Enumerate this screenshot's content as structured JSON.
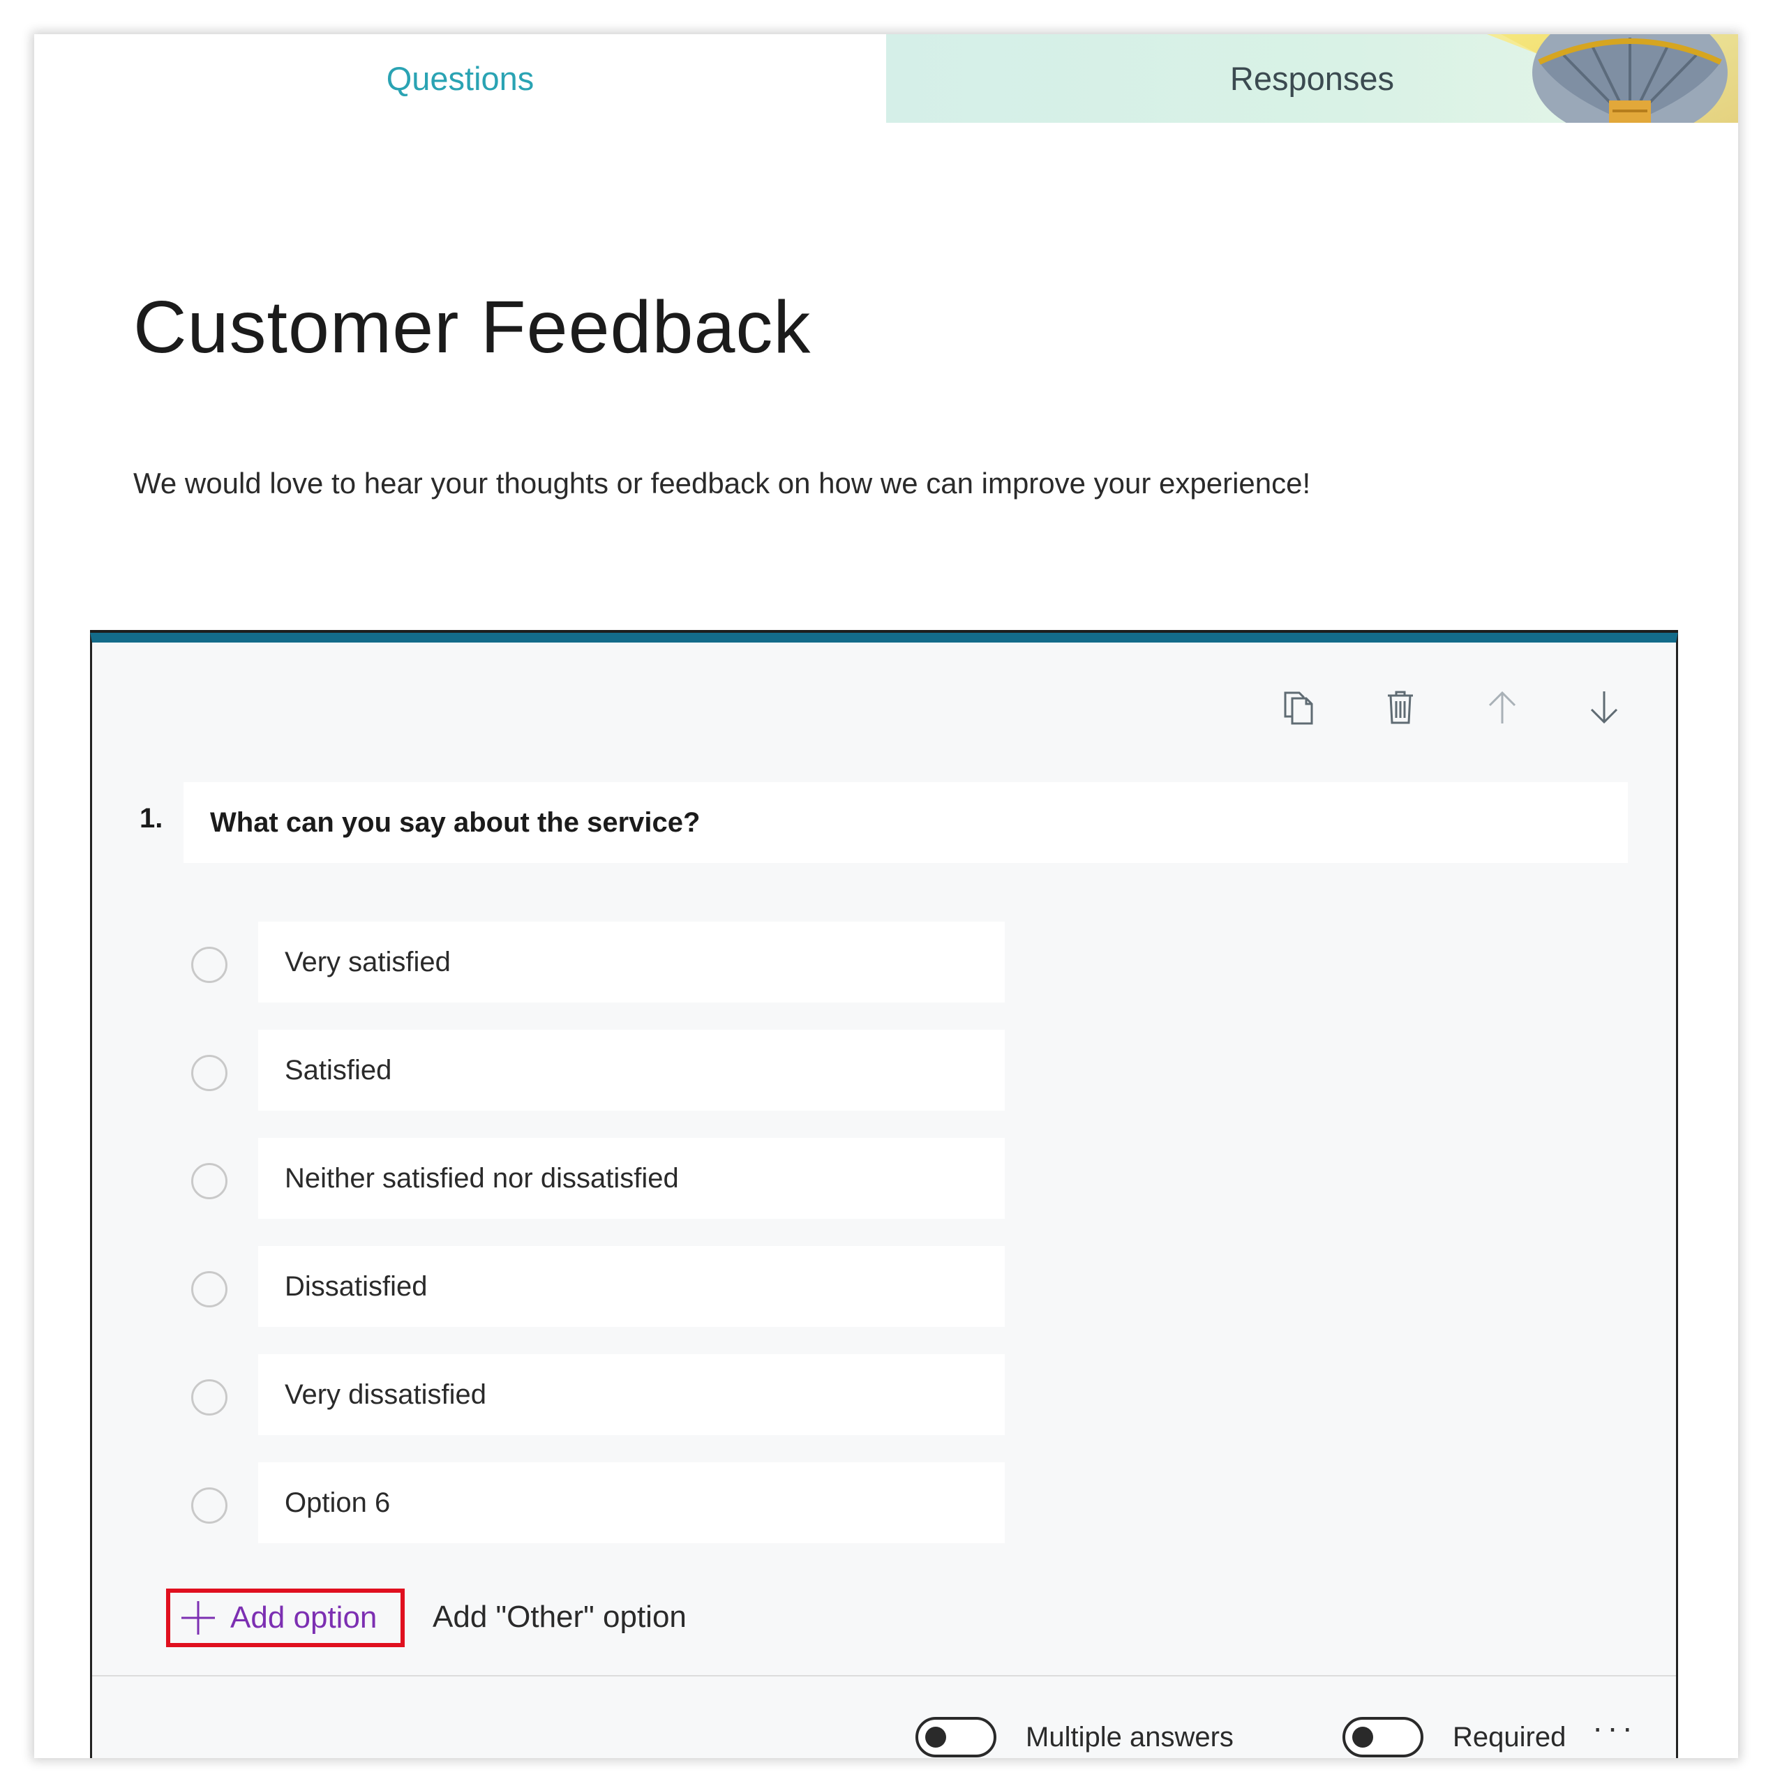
{
  "tabs": {
    "questions": "Questions",
    "responses": "Responses"
  },
  "form": {
    "title": "Customer Feedback",
    "description": "We would love to hear your thoughts or feedback on how we can improve your experience!"
  },
  "question": {
    "number": "1.",
    "text": "What can you say about the service?",
    "options": [
      "Very satisfied",
      "Satisfied",
      "Neither satisfied nor dissatisfied",
      "Dissatisfied",
      "Very dissatisfied",
      "Option 6"
    ],
    "add_option_label": "Add option",
    "add_other_label": "Add \"Other\" option",
    "multiple_answers_label": "Multiple answers",
    "required_label": "Required",
    "more_label": "···"
  },
  "colors": {
    "accent": "#2aa3b3",
    "card_top_border": "#136b8a",
    "highlight": "#e0101f",
    "add_option_text": "#7c2fb2"
  },
  "icons": [
    "copy-icon",
    "trash-icon",
    "arrow-up-icon",
    "arrow-down-icon",
    "plus-icon",
    "balloon-art"
  ]
}
